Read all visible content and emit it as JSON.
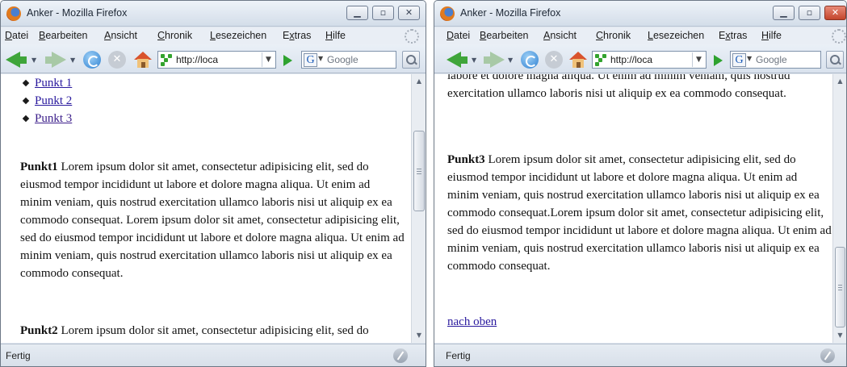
{
  "left_window": {
    "title": "Anker - Mozilla Firefox",
    "menu": {
      "datei": {
        "acc": "D",
        "rest": "atei"
      },
      "bearbeiten": {
        "acc": "B",
        "rest": "earbeiten"
      },
      "ansicht": {
        "acc": "A",
        "rest": "nsicht"
      },
      "chronik": {
        "acc": "C",
        "rest": "hronik"
      },
      "lesezeichen": {
        "acc": "L",
        "rest": "esezeichen"
      },
      "extras": {
        "pre": "E",
        "acc": "x",
        "rest": "tras"
      },
      "hilfe": {
        "acc": "H",
        "rest": "ilfe"
      }
    },
    "url": "http://loca",
    "search_placeholder": "Google",
    "links": [
      "Punkt 1",
      "Punkt 2",
      "Punkt 3"
    ],
    "paragraphs": [
      {
        "heading": "Punkt1",
        "text": " Lorem ipsum dolor sit amet, consectetur adipisicing elit, sed do eiusmod tempor incididunt ut labore et dolore magna aliqua. Ut enim ad minim veniam, quis nostrud exercitation ullamco laboris nisi ut aliquip ex ea commodo consequat. Lorem ipsum dolor sit amet, consectetur adipisicing elit, sed do eiusmod tempor incididunt ut labore et dolore magna aliqua. Ut enim ad minim veniam, quis nostrud exercitation ullamco laboris nisi ut aliquip ex ea commodo consequat."
      },
      {
        "heading": "Punkt2",
        "text": " Lorem ipsum dolor sit amet, consectetur adipisicing elit, sed do eiusmod tempor incididunt ut labore et dolore magna aliqua. Ut"
      }
    ],
    "status": "Fertig"
  },
  "right_window": {
    "title": "Anker - Mozilla Firefox",
    "menu": {
      "datei": {
        "acc": "D",
        "rest": "atei"
      },
      "bearbeiten": {
        "acc": "B",
        "rest": "earbeiten"
      },
      "ansicht": {
        "acc": "A",
        "rest": "nsicht"
      },
      "chronik": {
        "acc": "C",
        "rest": "hronik"
      },
      "lesezeichen": {
        "acc": "L",
        "rest": "esezeichen"
      },
      "extras": {
        "pre": "E",
        "acc": "x",
        "rest": "tras"
      },
      "hilfe": {
        "acc": "H",
        "rest": "ilfe"
      }
    },
    "url": "http://loca",
    "search_placeholder": "Google",
    "top_fragment": "labore et dolore magna aliqua. Ut enim ad minim veniam, quis nostrud exercitation ullamco laboris nisi ut aliquip ex ea commodo consequat.",
    "paragraph": {
      "heading": "Punkt3",
      "text": " Lorem ipsum dolor sit amet, consectetur adipisicing elit, sed do eiusmod tempor incididunt ut labore et dolore magna aliqua. Ut enim ad minim veniam, quis nostrud exercitation ullamco laboris nisi ut aliquip ex ea commodo consequat.Lorem ipsum dolor sit amet, consectetur adipisicing elit, sed do eiusmod tempor incididunt ut labore et dolore magna aliqua. Ut enim ad minim veniam, quis nostrud exercitation ullamco laboris nisi ut aliquip ex ea commodo consequat."
    },
    "back_link": "nach oben",
    "status": "Fertig"
  }
}
